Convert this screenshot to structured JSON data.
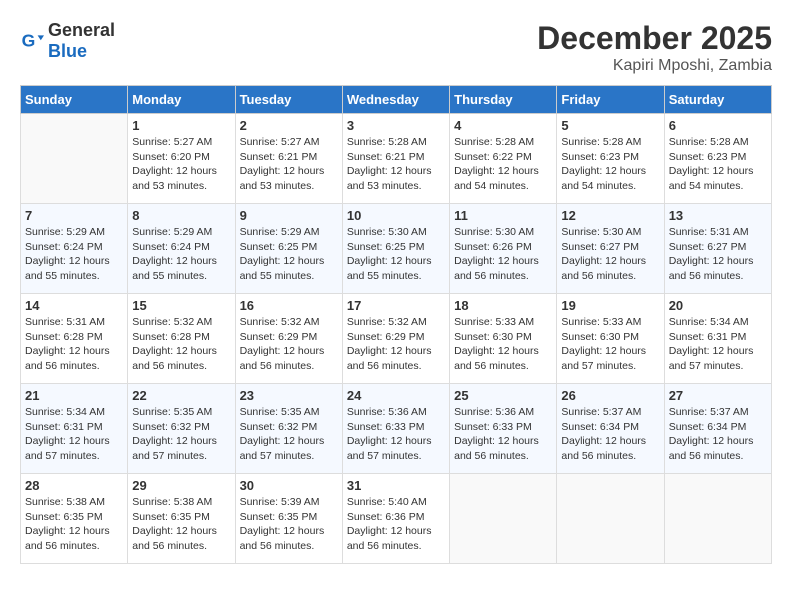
{
  "header": {
    "logo_general": "General",
    "logo_blue": "Blue",
    "month": "December 2025",
    "location": "Kapiri Mposhi, Zambia"
  },
  "weekdays": [
    "Sunday",
    "Monday",
    "Tuesday",
    "Wednesday",
    "Thursday",
    "Friday",
    "Saturday"
  ],
  "weeks": [
    [
      {
        "day": "",
        "info": ""
      },
      {
        "day": "1",
        "info": "Sunrise: 5:27 AM\nSunset: 6:20 PM\nDaylight: 12 hours\nand 53 minutes."
      },
      {
        "day": "2",
        "info": "Sunrise: 5:27 AM\nSunset: 6:21 PM\nDaylight: 12 hours\nand 53 minutes."
      },
      {
        "day": "3",
        "info": "Sunrise: 5:28 AM\nSunset: 6:21 PM\nDaylight: 12 hours\nand 53 minutes."
      },
      {
        "day": "4",
        "info": "Sunrise: 5:28 AM\nSunset: 6:22 PM\nDaylight: 12 hours\nand 54 minutes."
      },
      {
        "day": "5",
        "info": "Sunrise: 5:28 AM\nSunset: 6:23 PM\nDaylight: 12 hours\nand 54 minutes."
      },
      {
        "day": "6",
        "info": "Sunrise: 5:28 AM\nSunset: 6:23 PM\nDaylight: 12 hours\nand 54 minutes."
      }
    ],
    [
      {
        "day": "7",
        "info": "Sunrise: 5:29 AM\nSunset: 6:24 PM\nDaylight: 12 hours\nand 55 minutes."
      },
      {
        "day": "8",
        "info": "Sunrise: 5:29 AM\nSunset: 6:24 PM\nDaylight: 12 hours\nand 55 minutes."
      },
      {
        "day": "9",
        "info": "Sunrise: 5:29 AM\nSunset: 6:25 PM\nDaylight: 12 hours\nand 55 minutes."
      },
      {
        "day": "10",
        "info": "Sunrise: 5:30 AM\nSunset: 6:25 PM\nDaylight: 12 hours\nand 55 minutes."
      },
      {
        "day": "11",
        "info": "Sunrise: 5:30 AM\nSunset: 6:26 PM\nDaylight: 12 hours\nand 56 minutes."
      },
      {
        "day": "12",
        "info": "Sunrise: 5:30 AM\nSunset: 6:27 PM\nDaylight: 12 hours\nand 56 minutes."
      },
      {
        "day": "13",
        "info": "Sunrise: 5:31 AM\nSunset: 6:27 PM\nDaylight: 12 hours\nand 56 minutes."
      }
    ],
    [
      {
        "day": "14",
        "info": "Sunrise: 5:31 AM\nSunset: 6:28 PM\nDaylight: 12 hours\nand 56 minutes."
      },
      {
        "day": "15",
        "info": "Sunrise: 5:32 AM\nSunset: 6:28 PM\nDaylight: 12 hours\nand 56 minutes."
      },
      {
        "day": "16",
        "info": "Sunrise: 5:32 AM\nSunset: 6:29 PM\nDaylight: 12 hours\nand 56 minutes."
      },
      {
        "day": "17",
        "info": "Sunrise: 5:32 AM\nSunset: 6:29 PM\nDaylight: 12 hours\nand 56 minutes."
      },
      {
        "day": "18",
        "info": "Sunrise: 5:33 AM\nSunset: 6:30 PM\nDaylight: 12 hours\nand 56 minutes."
      },
      {
        "day": "19",
        "info": "Sunrise: 5:33 AM\nSunset: 6:30 PM\nDaylight: 12 hours\nand 57 minutes."
      },
      {
        "day": "20",
        "info": "Sunrise: 5:34 AM\nSunset: 6:31 PM\nDaylight: 12 hours\nand 57 minutes."
      }
    ],
    [
      {
        "day": "21",
        "info": "Sunrise: 5:34 AM\nSunset: 6:31 PM\nDaylight: 12 hours\nand 57 minutes."
      },
      {
        "day": "22",
        "info": "Sunrise: 5:35 AM\nSunset: 6:32 PM\nDaylight: 12 hours\nand 57 minutes."
      },
      {
        "day": "23",
        "info": "Sunrise: 5:35 AM\nSunset: 6:32 PM\nDaylight: 12 hours\nand 57 minutes."
      },
      {
        "day": "24",
        "info": "Sunrise: 5:36 AM\nSunset: 6:33 PM\nDaylight: 12 hours\nand 57 minutes."
      },
      {
        "day": "25",
        "info": "Sunrise: 5:36 AM\nSunset: 6:33 PM\nDaylight: 12 hours\nand 56 minutes."
      },
      {
        "day": "26",
        "info": "Sunrise: 5:37 AM\nSunset: 6:34 PM\nDaylight: 12 hours\nand 56 minutes."
      },
      {
        "day": "27",
        "info": "Sunrise: 5:37 AM\nSunset: 6:34 PM\nDaylight: 12 hours\nand 56 minutes."
      }
    ],
    [
      {
        "day": "28",
        "info": "Sunrise: 5:38 AM\nSunset: 6:35 PM\nDaylight: 12 hours\nand 56 minutes."
      },
      {
        "day": "29",
        "info": "Sunrise: 5:38 AM\nSunset: 6:35 PM\nDaylight: 12 hours\nand 56 minutes."
      },
      {
        "day": "30",
        "info": "Sunrise: 5:39 AM\nSunset: 6:35 PM\nDaylight: 12 hours\nand 56 minutes."
      },
      {
        "day": "31",
        "info": "Sunrise: 5:40 AM\nSunset: 6:36 PM\nDaylight: 12 hours\nand 56 minutes."
      },
      {
        "day": "",
        "info": ""
      },
      {
        "day": "",
        "info": ""
      },
      {
        "day": "",
        "info": ""
      }
    ]
  ]
}
